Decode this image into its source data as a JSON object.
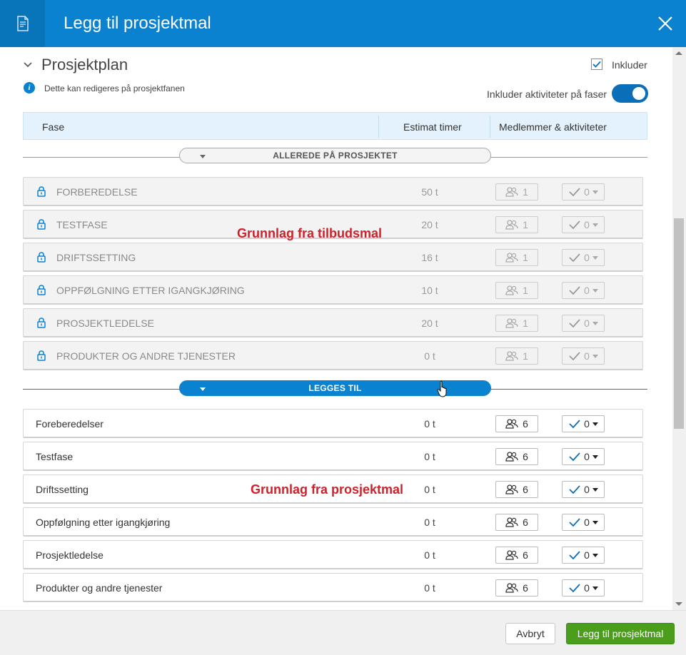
{
  "dialog": {
    "title": "Legg til prosjektmal",
    "header_icon": "document-icon",
    "close_icon": "close-icon"
  },
  "section": {
    "title": "Prosjektplan",
    "include_label": "Inkluder",
    "include_checked": true,
    "info_text": "Dette kan redigeres på prosjektfanen",
    "toggle_label": "Inkluder aktiviteter på faser",
    "toggle_on": true
  },
  "table": {
    "columns": [
      "Fase",
      "Estimat timer",
      "Medlemmer & aktiviteter"
    ]
  },
  "existing": {
    "label": "ALLEREDE PÅ PROSJEKTET",
    "rows": [
      {
        "name": "FORBEREDELSE",
        "estimate": "50 t",
        "members": "1",
        "activities": "0"
      },
      {
        "name": "TESTFASE",
        "estimate": "20 t",
        "members": "1",
        "activities": "0"
      },
      {
        "name": "DRIFTSSETTING",
        "estimate": "16 t",
        "members": "1",
        "activities": "0"
      },
      {
        "name": "OPPFØLGNING ETTER IGANGKJØRING",
        "estimate": "10 t",
        "members": "1",
        "activities": "0"
      },
      {
        "name": "PROSJEKTLEDELSE",
        "estimate": "20 t",
        "members": "1",
        "activities": "0"
      },
      {
        "name": "PRODUKTER OG ANDRE TJENESTER",
        "estimate": "0 t",
        "members": "1",
        "activities": "0"
      }
    ]
  },
  "added": {
    "label": "LEGGES TIL",
    "rows": [
      {
        "name": "Foreberedelser",
        "estimate": "0 t",
        "members": "6",
        "activities": "0"
      },
      {
        "name": "Testfase",
        "estimate": "0 t",
        "members": "6",
        "activities": "0"
      },
      {
        "name": "Driftssetting",
        "estimate": "0 t",
        "members": "6",
        "activities": "0"
      },
      {
        "name": "Oppfølgning etter igangkjøring",
        "estimate": "0 t",
        "members": "6",
        "activities": "0"
      },
      {
        "name": "Prosjektledelse",
        "estimate": "0 t",
        "members": "6",
        "activities": "0"
      },
      {
        "name": "Produkter og andre tjenester",
        "estimate": "0 t",
        "members": "6",
        "activities": "0"
      }
    ]
  },
  "annotations": {
    "existing": "Grunnlag fra tilbudsmal",
    "added": "Grunnlag fra prosjektmal"
  },
  "footer": {
    "cancel_label": "Avbryt",
    "submit_label": "Legg til prosjektmal"
  },
  "colors": {
    "header": "#0a82cf",
    "primary_button": "#4a9e1c",
    "annotation": "#d0212a"
  }
}
